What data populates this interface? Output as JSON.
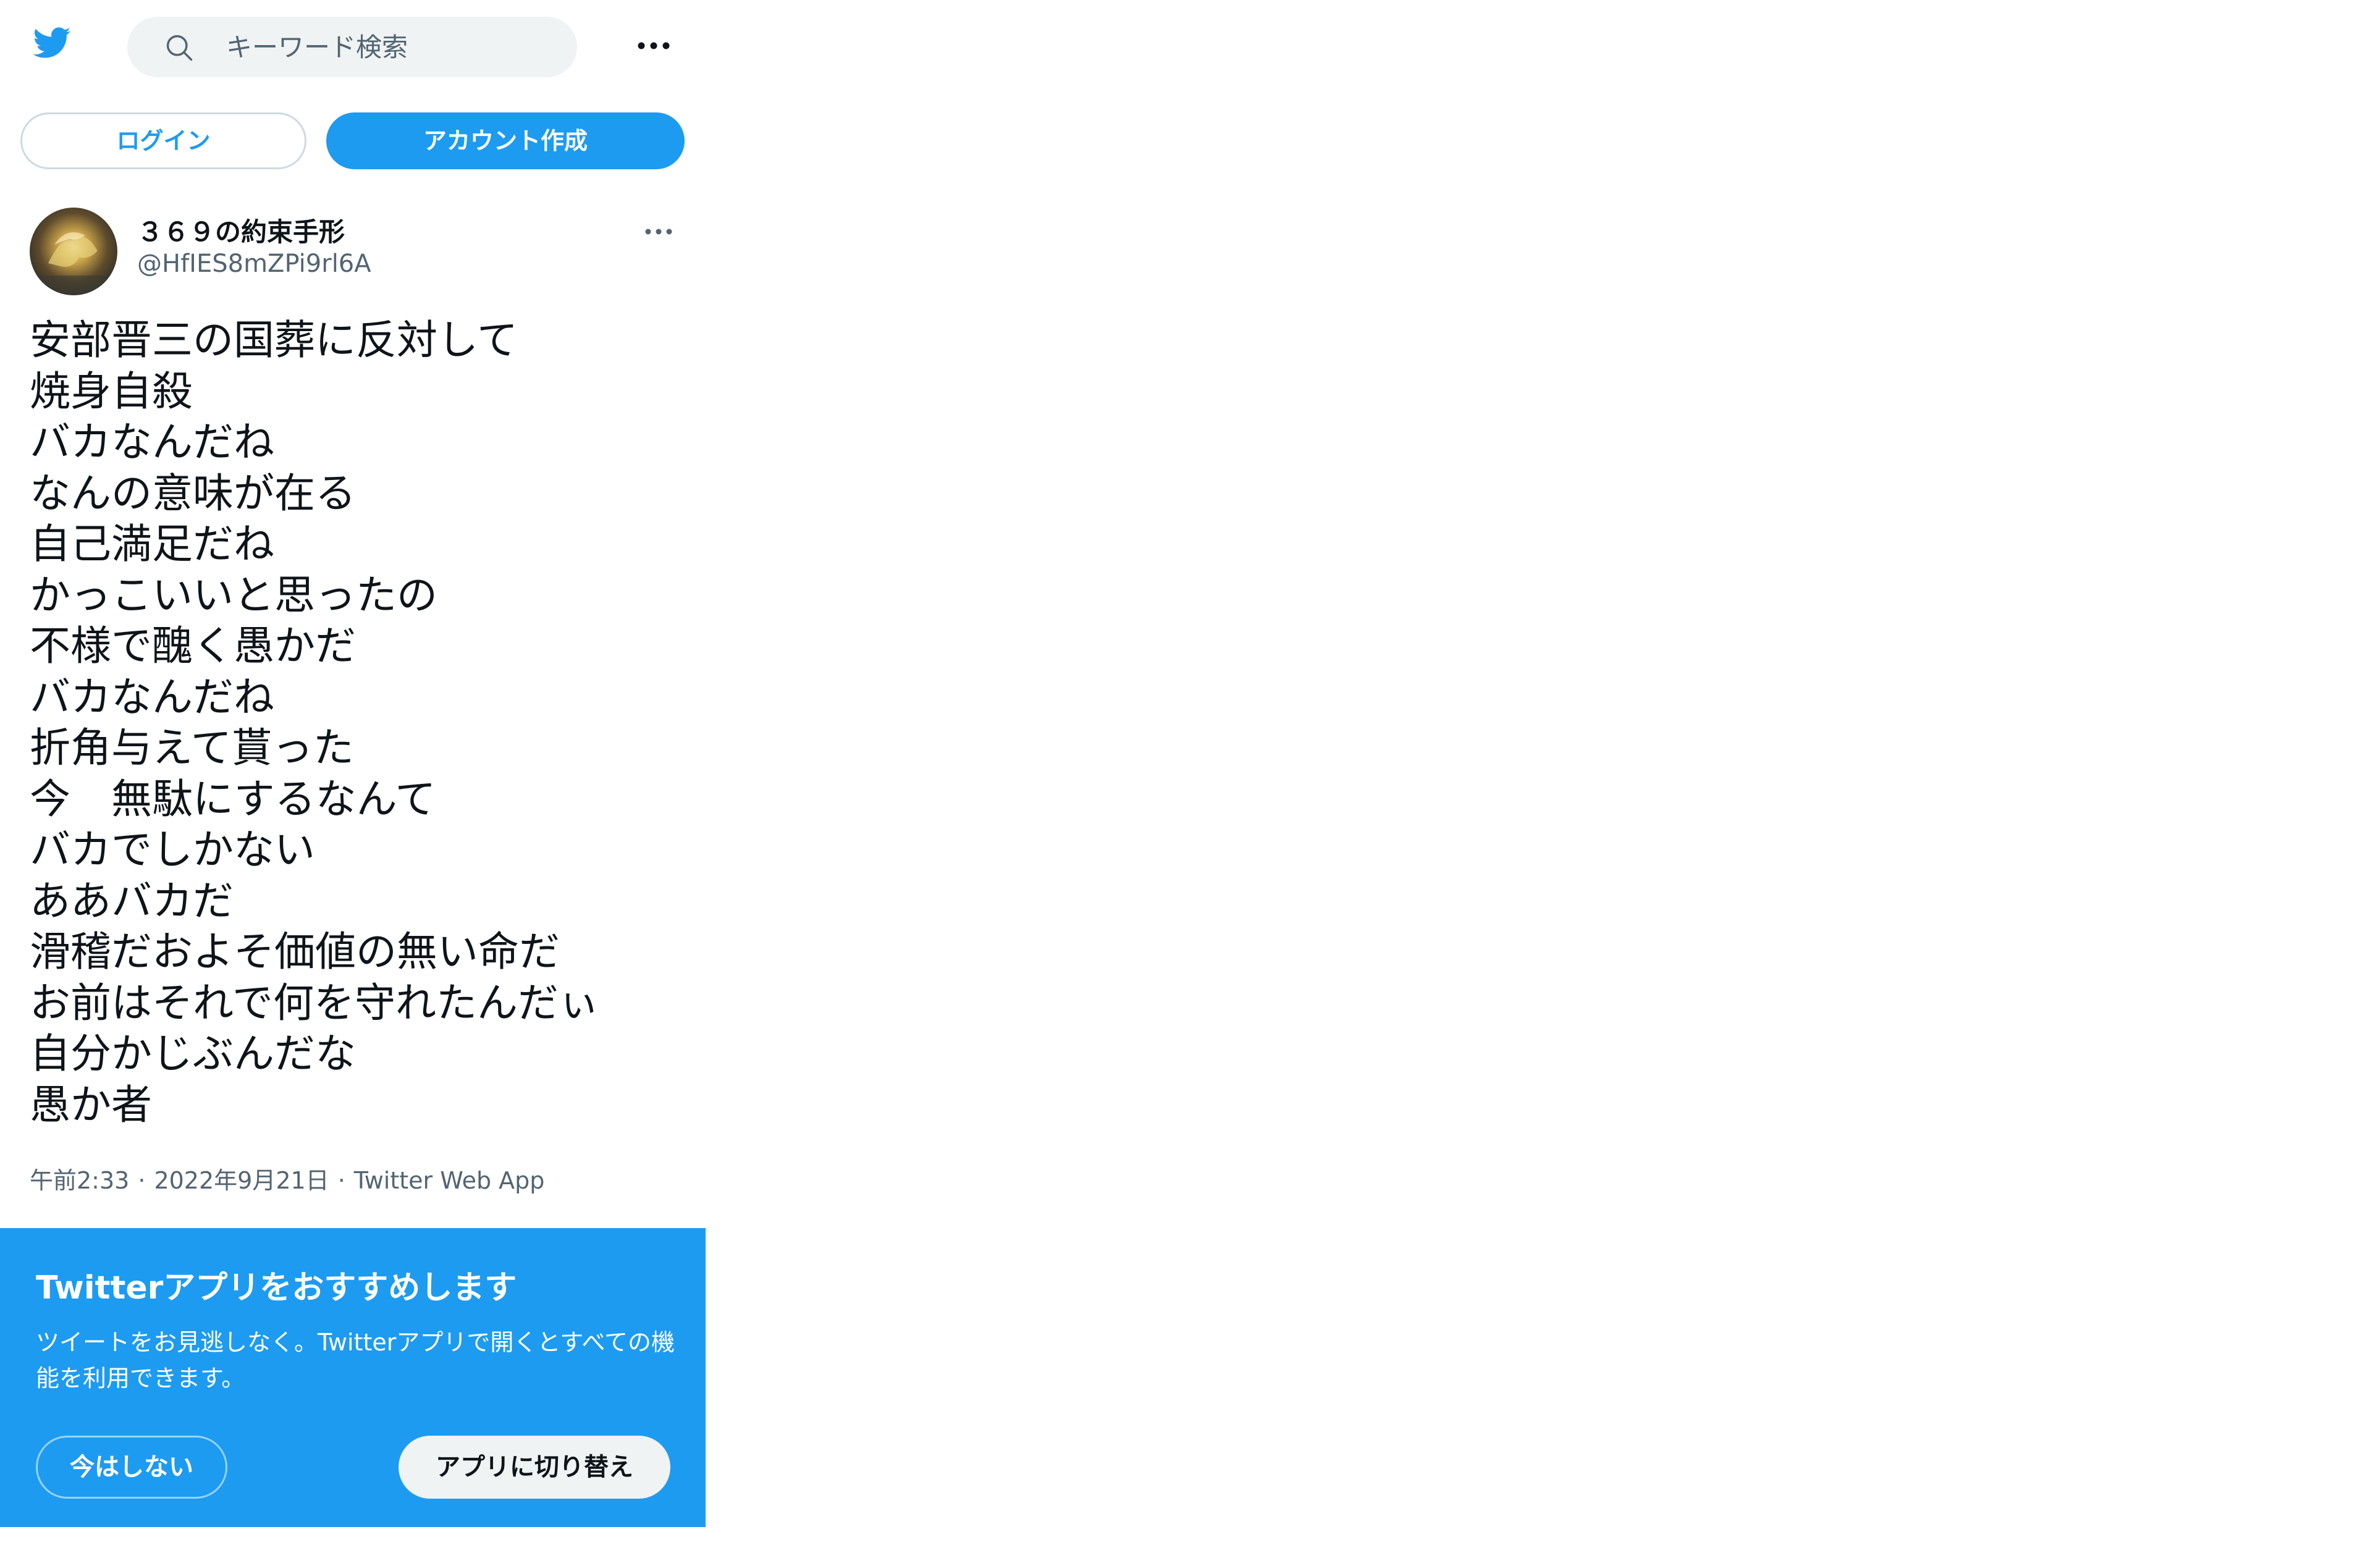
{
  "header": {
    "logo_icon": "twitter-bird-icon",
    "search": {
      "icon": "search-icon",
      "placeholder": "キーワード検索"
    },
    "more_icon": "more-dots-icon"
  },
  "auth": {
    "login_label": "ログイン",
    "signup_label": "アカウント作成"
  },
  "tweet": {
    "display_name": "３６９の約束手形",
    "handle": "@HfIES8mZPi9rl6A",
    "lines": [
      "安部晋三の国葬に反対して",
      "焼身自殺",
      "バカなんだね",
      "なんの意味が在る",
      "自己満足だね",
      "かっこいいと思ったの",
      "不様で醜く愚かだ",
      "バカなんだね",
      "折角与えて貰った",
      "今　無駄にするなんて",
      "バカでしかない",
      "ああバカだ",
      "滑稽だおよそ価値の無い命だ",
      "お前はそれで何を守れたんだぃ",
      "自分かじぶんだな",
      "愚か者"
    ],
    "time": "午前2:33",
    "date": "2022年9月21日",
    "source": "Twitter Web App",
    "separator": "·"
  },
  "banner": {
    "title": "Twitterアプリをおすすめします",
    "body": "ツイートをお見逃しなく。Twitterアプリで開くとすべての機能を利用できます。",
    "not_now_label": "今はしない",
    "switch_label": "アプリに切り替え"
  },
  "colors": {
    "brand": "#1d9bf0",
    "text_primary": "#0f1419",
    "text_secondary": "#536471",
    "search_bg": "#eff3f4"
  }
}
